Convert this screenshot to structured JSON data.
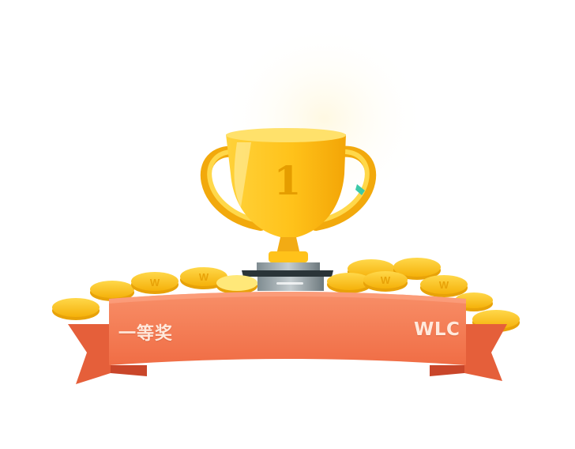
{
  "prize": {
    "label": "一等奖"
  },
  "brand": {
    "label": "WLC"
  },
  "trophy": {
    "rank_number": "1"
  },
  "coins": {
    "mark": "W"
  },
  "colors": {
    "ribbon": "#f47e56",
    "ribbon_dark": "#de5a36",
    "gold": "#ffc81e",
    "gold_dark": "#f0a000",
    "base": "#2f3b40"
  },
  "icons": [
    "trophy-icon",
    "gold-coin-icon",
    "ribbon-banner"
  ]
}
